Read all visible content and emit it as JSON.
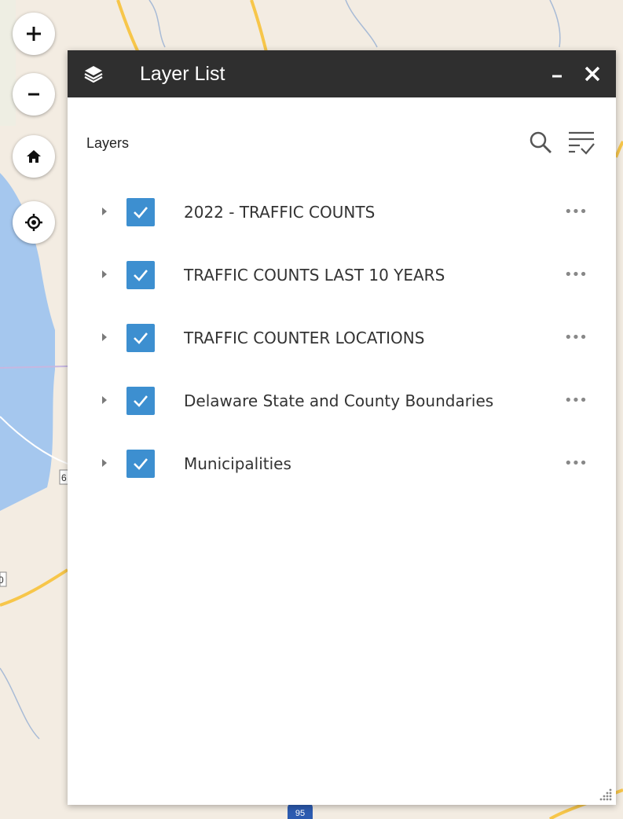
{
  "panel": {
    "title": "Layer List",
    "section_label": "Layers",
    "header_bg": "#2f2f2f",
    "checkbox_color": "#3d8fd0"
  },
  "map_controls": {
    "zoom_in_icon": "plus-icon",
    "zoom_out_icon": "minus-icon",
    "home_icon": "home-icon",
    "locate_icon": "locate-icon"
  },
  "map_labels": {
    "route_shield": "95",
    "edge_label_1": "6",
    "edge_label_2": "0"
  },
  "layers": [
    {
      "name": "2022 - TRAFFIC COUNTS",
      "checked": true
    },
    {
      "name": "TRAFFIC COUNTS LAST 10 YEARS",
      "checked": true
    },
    {
      "name": "TRAFFIC COUNTER LOCATIONS",
      "checked": true
    },
    {
      "name": "Delaware State and County Boundaries",
      "checked": true
    },
    {
      "name": "Municipalities",
      "checked": true
    }
  ],
  "icons": {
    "menu": "ellipsis-icon",
    "more_glyph": "•••"
  }
}
